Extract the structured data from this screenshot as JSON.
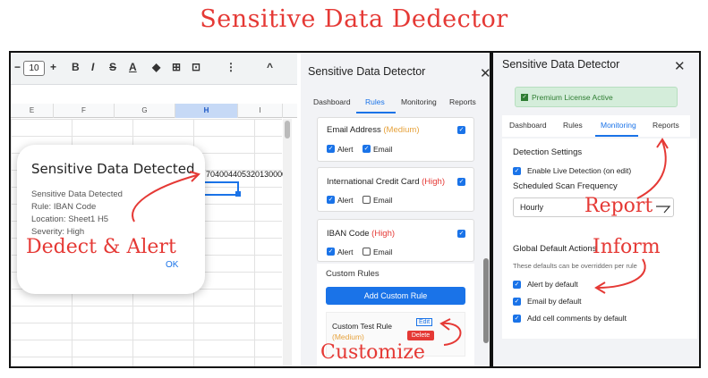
{
  "title": "Sensitive Data Dedector",
  "toolbar": {
    "font_size": "10",
    "items": [
      "−",
      "+",
      "B",
      "I",
      "S",
      "A",
      "◆",
      "⊞",
      "⊡",
      "⋮",
      "^"
    ]
  },
  "sheet": {
    "columns": [
      "E",
      "F",
      "G",
      "H",
      "I"
    ],
    "selected_column": "H",
    "cell_value": "704004405320130000"
  },
  "popup": {
    "title": "Sensitive Data Detected",
    "lines": [
      "Sensitive Data Detected",
      "Rule: IBAN Code",
      "Location: Sheet1 H5",
      "Severity: High"
    ],
    "ok_label": "OK"
  },
  "addon_left": {
    "title": "Sensitive Data Detector",
    "close": "✕",
    "tabs": [
      "Dashboard",
      "Rules",
      "Monitoring",
      "Reports"
    ],
    "active_tab": "Rules",
    "rules": [
      {
        "name": "Email Address",
        "severity": "(Medium)",
        "alert_label": "Alert",
        "email_label": "Email",
        "alert": true,
        "email": true
      },
      {
        "name": "International Credit Card",
        "severity": "(High)",
        "alert_label": "Alert",
        "email_label": "Email",
        "alert": true,
        "email": false
      },
      {
        "name": "IBAN Code",
        "severity": "(High)",
        "alert_label": "Alert",
        "email_label": "Email",
        "alert": true,
        "email": false
      }
    ],
    "custom_rules_heading": "Custom Rules",
    "add_custom_rule": "Add Custom Rule",
    "custom_rule": {
      "name": "Custom Test Rule",
      "severity": "(Medium)",
      "edit": "Edit",
      "delete": "Delete"
    }
  },
  "addon_right": {
    "title": "Sensitive Data Detector",
    "close": "✕",
    "license": "Premium License Active",
    "tabs": [
      "Dashboard",
      "Rules",
      "Monitoring",
      "Reports"
    ],
    "active_tab": "Monitoring",
    "detection_heading": "Detection Settings",
    "enable_live": "Enable Live Detection (on edit)",
    "frequency_label": "Scheduled Scan Frequency",
    "frequency_value": "Hourly",
    "global_heading": "Global Default Actions",
    "global_note": "These defaults can be overridden per rule",
    "alert_default": "Alert by default",
    "email_default": "Email by default",
    "comments_default": "Add cell comments by default"
  },
  "annotations": {
    "alert": "Dedect & Alert",
    "customize": "Customize",
    "report": "Report",
    "inform": "Inform"
  },
  "colors": {
    "accent": "#1a73e8",
    "annotation": "#e53935",
    "medium": "#e6a23c",
    "license_bg": "#d4edda"
  }
}
